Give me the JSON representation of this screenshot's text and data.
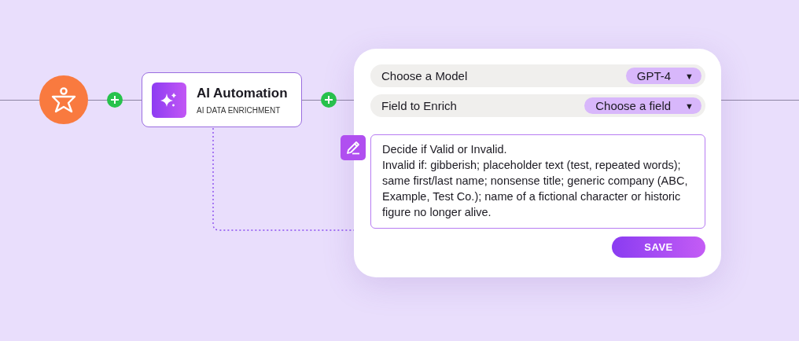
{
  "trigger": {
    "kind": "person"
  },
  "node": {
    "title": "AI Automation",
    "subtitle": "AI DATA ENRICHMENT"
  },
  "panel": {
    "fields": [
      {
        "label": "Choose a Model",
        "value": "GPT-4",
        "caret": "▼"
      },
      {
        "label": "Field to Enrich",
        "value": "Choose a field",
        "caret": "▼"
      }
    ],
    "prompt": "Decide if Valid or Invalid.\nInvalid if: gibberish; placeholder text (test, repeated words); same first/last name; nonsense title; generic company (ABC, Example, Test Co.); name of a fictional character or historic figure no longer alive.",
    "save": "SAVE"
  }
}
